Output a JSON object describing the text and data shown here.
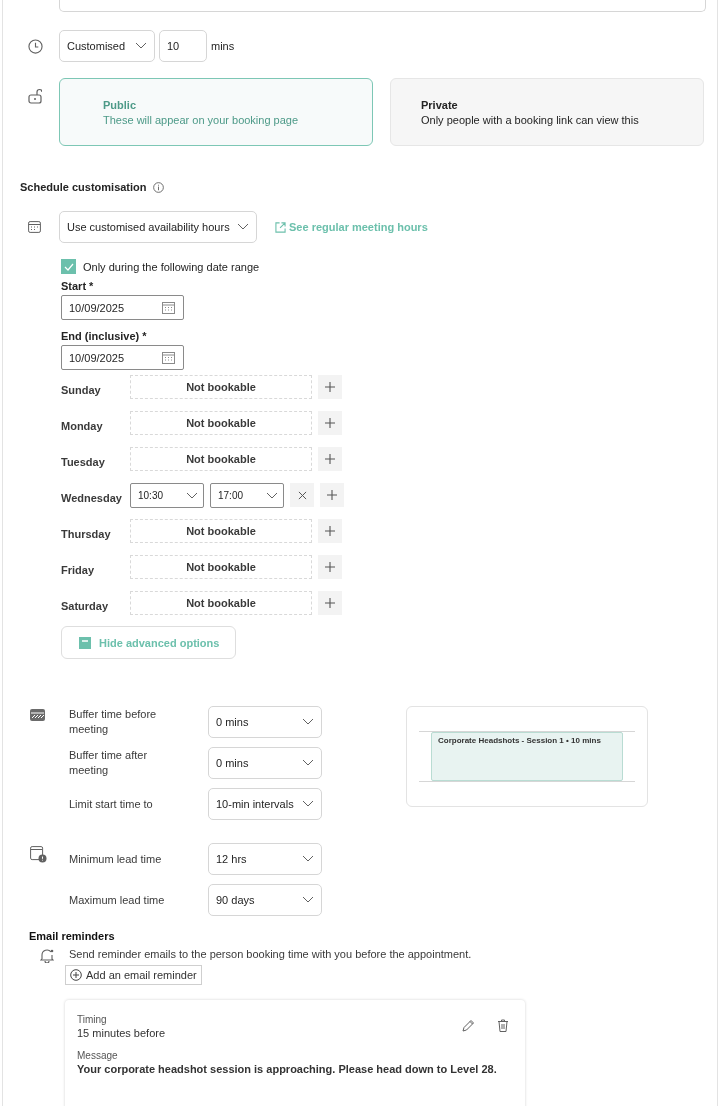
{
  "duration": {
    "mode": "Customised",
    "value": "10",
    "unit": "mins"
  },
  "visibility": [
    {
      "title": "Public",
      "description": "These will appear on your booking page",
      "selected": true
    },
    {
      "title": "Private",
      "description": "Only people with a booking link can view this",
      "selected": false
    }
  ],
  "schedule": {
    "heading": "Schedule customisation",
    "availability": "Use customised availability hours",
    "link": "See regular meeting hours",
    "date_range": {
      "label": "Only during the following date range",
      "checked": true
    },
    "start": {
      "label": "Start *",
      "value": "10/09/2025"
    },
    "end": {
      "label": "End (inclusive) *",
      "value": "10/09/2025"
    },
    "days": [
      {
        "name": "Sunday",
        "kind": "unavailable",
        "text": "Not bookable"
      },
      {
        "name": "Monday",
        "kind": "unavailable",
        "text": "Not bookable"
      },
      {
        "name": "Tuesday",
        "kind": "unavailable",
        "text": "Not bookable"
      },
      {
        "name": "Wednesday",
        "kind": "hours",
        "from": "10:30",
        "to": "17:00"
      },
      {
        "name": "Thursday",
        "kind": "unavailable",
        "text": "Not bookable"
      },
      {
        "name": "Friday",
        "kind": "unavailable",
        "text": "Not bookable"
      },
      {
        "name": "Saturday",
        "kind": "unavailable",
        "text": "Not bookable"
      }
    ],
    "toggle_button": "Hide advanced options"
  },
  "buffer": [
    {
      "label": "Buffer time before meeting",
      "value": "0 mins"
    },
    {
      "label": "Buffer time after meeting",
      "value": "0 mins"
    },
    {
      "label": "Limit start time to",
      "value": "10-min intervals"
    }
  ],
  "preview": {
    "title": "Corporate Headshots - Session 1 • 10 mins"
  },
  "lead": [
    {
      "label": "Minimum lead time",
      "value": "12 hrs"
    },
    {
      "label": "Maximum lead time",
      "value": "90 days"
    }
  ],
  "email_reminders": {
    "heading": "Email reminders",
    "description": "Send reminder emails to the person booking time with you before the appointment.",
    "add_button": "Add an email reminder",
    "reminders": [
      {
        "timing_label": "Timing",
        "timing": "15 minutes before",
        "message_label": "Message",
        "message": "Your corporate headshot session is approaching. Please head down to Level 28."
      }
    ]
  }
}
